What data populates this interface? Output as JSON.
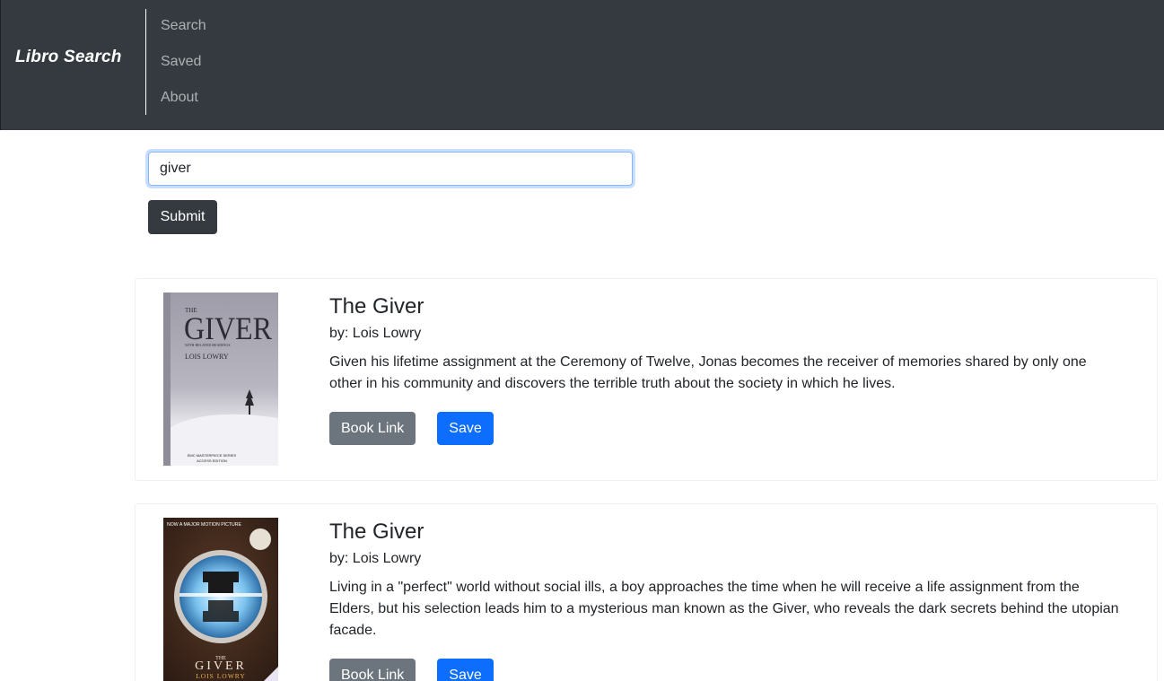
{
  "navbar": {
    "brand": "Libro Search",
    "links": [
      "Search",
      "Saved",
      "About"
    ]
  },
  "search": {
    "value": "giver",
    "submit_label": "Submit"
  },
  "results": [
    {
      "title": "The Giver",
      "author": "by: Lois Lowry",
      "description": "Given his lifetime assignment at the Ceremony of Twelve, Jonas becomes the receiver of memories shared by only one other in his community and discovers the terrible truth about the society in which he lives.",
      "cover": {
        "title": "GIVER",
        "title_prefix": "THE",
        "subtitle": "WITH RELATED READINGS",
        "author": "LOIS LOWRY",
        "series_line1": "EMC MASTERPIECE SERIES",
        "series_line2": "ACCESS EDITION"
      },
      "link_label": "Book Link",
      "save_label": "Save"
    },
    {
      "title": "The Giver",
      "author": "by: Lois Lowry",
      "description": "Living in a \"perfect\" world without social ills, a boy approaches the time when he will receive a life assignment from the Elders, but his selection leads him to a mysterious man known as the Giver, who reveals the dark secrets behind the utopian facade.",
      "cover": {
        "banner": "NOW A MAJOR MOTION PICTURE",
        "title_prefix": "THE",
        "title": "GIVER",
        "author": "LOIS LOWRY"
      },
      "link_label": "Book Link",
      "save_label": "Save"
    }
  ],
  "colors": {
    "navbar": "#343a40",
    "primary": "#0d6efd",
    "secondary": "#6c757d"
  }
}
